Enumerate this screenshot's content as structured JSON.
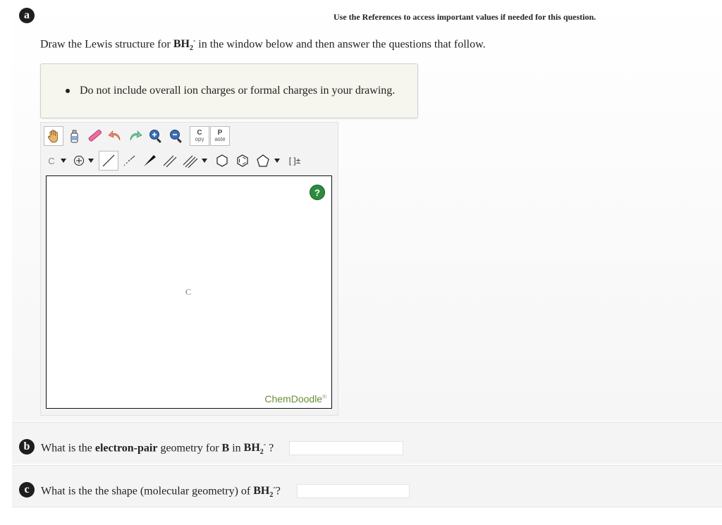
{
  "header": {
    "badge_a": "a",
    "references": "Use the References to access important values if needed for this question."
  },
  "question_a": {
    "prefix": "Draw the Lewis structure for ",
    "formula_main": "BH",
    "formula_sub": "2",
    "formula_sup": "-",
    "suffix": " in the window below and then answer the questions that follow."
  },
  "note": {
    "bullet": "Do not include overall ion charges or formal charges in your drawing."
  },
  "chemdoodle": {
    "copy_top": "C",
    "copy_bottom": "opy",
    "paste_top": "P",
    "paste_bottom": "aste",
    "atom_button": "C",
    "atom_on_canvas": "C",
    "help": "?",
    "brand": "ChemDoodle",
    "brand_mark": "®",
    "bracket_button": "[ ]±"
  },
  "question_b": {
    "badge": "b",
    "prefix": "What is the ",
    "bold": "electron-pair",
    "middle": " geometry for ",
    "atom": "B",
    "in": " in ",
    "formula_main": "BH",
    "formula_sub": "2",
    "formula_sup": "-",
    "suffix": " ?",
    "answer_value": ""
  },
  "question_c": {
    "badge": "c",
    "prefix": "What is the the shape (molecular geometry) of ",
    "formula_main": "BH",
    "formula_sub": "2",
    "formula_sup": "-",
    "suffix": "?",
    "answer_value": ""
  }
}
